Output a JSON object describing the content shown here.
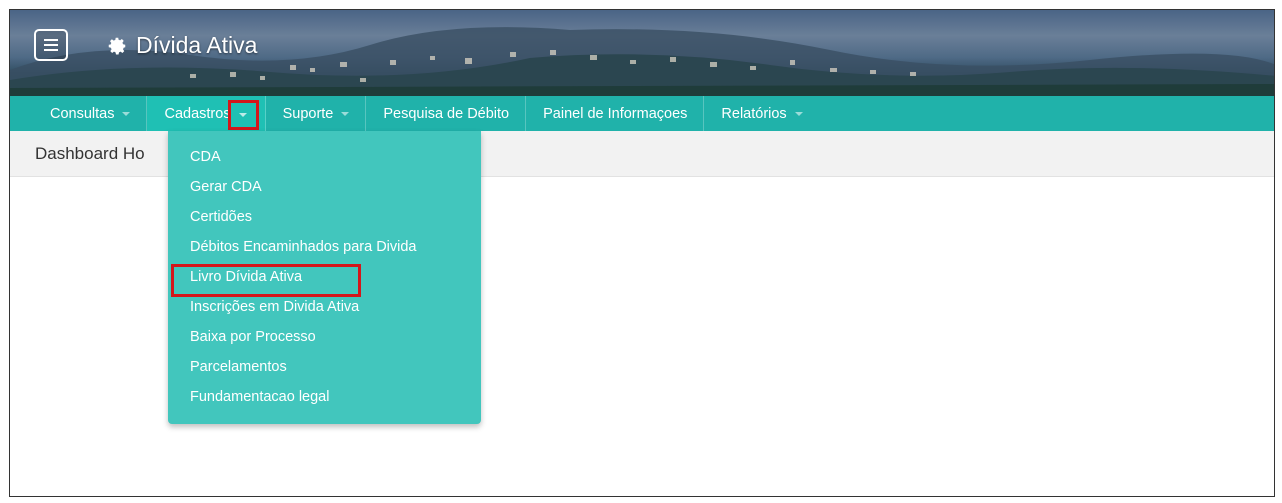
{
  "header": {
    "title": "Dívida Ativa",
    "menu_icon": "hamburger-icon",
    "logo_icon": "gear-icon"
  },
  "nav": {
    "items": [
      {
        "label": "Consultas",
        "has_caret": true
      },
      {
        "label": "Cadastros",
        "has_caret": true,
        "active": true
      },
      {
        "label": "Suporte",
        "has_caret": true
      },
      {
        "label": "Pesquisa de Débito",
        "has_caret": false
      },
      {
        "label": "Painel de Informaçoes",
        "has_caret": false
      },
      {
        "label": "Relatórios",
        "has_caret": true
      }
    ]
  },
  "breadcrumb": {
    "text": "Dashboard Ho"
  },
  "dropdown": {
    "items": [
      "CDA",
      "Gerar CDA",
      "Certidões",
      "Débitos Encaminhados para Divida",
      "Livro Dívida Ativa",
      "Inscrições em Divida Ativa",
      "Baixa por Processo",
      "Parcelamentos",
      "Fundamentacao legal"
    ],
    "highlighted": "Livro Dívida Ativa"
  },
  "colors": {
    "navbar": "#20b2aa",
    "dropdown": "#42c6bd",
    "highlight": "#d4161b"
  }
}
